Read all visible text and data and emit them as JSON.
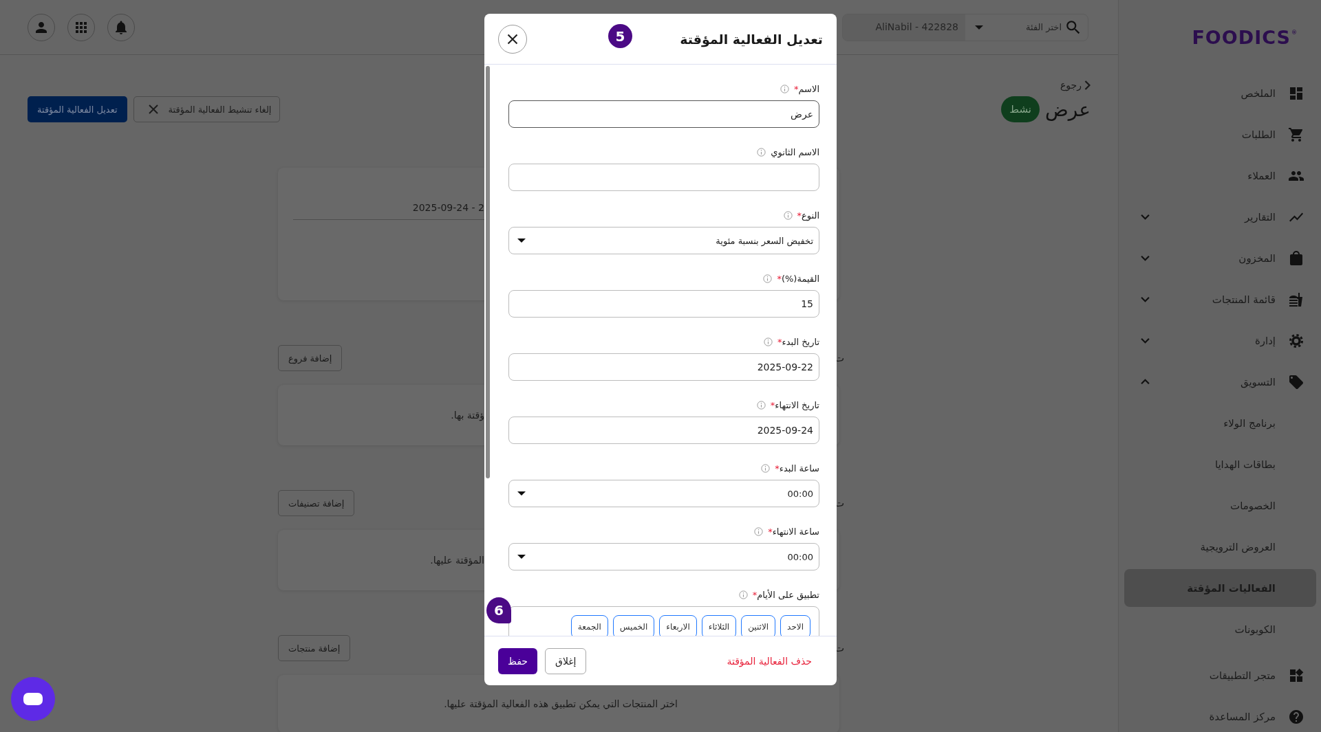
{
  "topbar": {
    "category_placeholder": "اختر الفئة",
    "account": "AliNabil - 422828"
  },
  "page": {
    "back": "رجوع",
    "title": "عرض",
    "status": "نشط",
    "actions": [
      {
        "label": "إلغاء تنشيط الفعالية المؤقتة",
        "kind": "outlined"
      },
      {
        "label": "تعديل الفعالية المؤقتة",
        "kind": "filled"
      }
    ]
  },
  "sections": [
    {
      "kind": "period",
      "value": "2025-09-24 - 2"
    },
    {
      "kind": "list",
      "heading": "ت",
      "button": "إضافة فروع",
      "text": "ؤقتة بها."
    },
    {
      "kind": "list",
      "heading": "ت",
      "button": "إضافة تصنيفات",
      "text": "المؤقتة عليها."
    },
    {
      "kind": "list",
      "heading": "ت",
      "button": "إضافة منتجات",
      "text": "اختر المنتجات التي يمكن تطبيق هذه الفعالية المؤقتة عليها."
    }
  ],
  "modal": {
    "title": "تعديل الفعالية المؤقتة",
    "marker": "5",
    "required_mark": "*",
    "fields": [
      {
        "kind": "text",
        "label": "الاسم",
        "required": true,
        "focused": true,
        "value": "عرض"
      },
      {
        "kind": "text",
        "label": "الاسم الثانوي",
        "required": false,
        "focused": false
      },
      {
        "kind": "select",
        "label": "النوع",
        "required": true,
        "focused": false,
        "value": "تخفيض السعر بنسبة مئوية"
      },
      {
        "kind": "text",
        "label": "القيمة(%)",
        "required": true,
        "focused": false,
        "value": "15"
      },
      {
        "kind": "text",
        "label": "تاريخ البدء",
        "required": true,
        "focused": false,
        "value": "2025-09-22"
      },
      {
        "kind": "text",
        "label": "تاريخ الانتهاء",
        "required": true,
        "focused": false,
        "value": "2025-09-24"
      },
      {
        "kind": "select",
        "label": "ساعة البدء",
        "required": true,
        "focused": false,
        "value": "00:00"
      },
      {
        "kind": "select",
        "label": "ساعة الانتهاء",
        "required": true,
        "focused": false,
        "value": "00:00"
      }
    ],
    "days": {
      "label": "تطبيق على الأيام",
      "required": true,
      "marker": "6",
      "items": [
        {
          "label": "الاحد",
          "selected": true
        },
        {
          "label": "الاثنين",
          "selected": true
        },
        {
          "label": "الثلاثاء",
          "selected": true
        },
        {
          "label": "الاربعاء",
          "selected": true
        },
        {
          "label": "الخميس",
          "selected": true
        },
        {
          "label": "الجمعة",
          "selected": true
        }
      ]
    },
    "delete": "حذف الفعالية المؤقتة",
    "buttons": [
      {
        "label": "إغلاق",
        "kind": "secondary"
      },
      {
        "label": "حفظ",
        "kind": "primary"
      }
    ]
  },
  "sidebar": {
    "logo": "FOODICS$^{®}$",
    "items": [
      {
        "label": "الملخص",
        "selected": false
      },
      {
        "label": "الطلبات",
        "selected": false
      },
      {
        "label": "العملاء",
        "selected": false
      },
      {
        "label": "التقارير",
        "selected": false,
        "expanded": false
      },
      {
        "label": "المخزون",
        "selected": false,
        "expanded": false
      },
      {
        "label": "قائمة المنتجات",
        "selected": false,
        "expanded": false
      },
      {
        "label": "إدارة",
        "selected": false,
        "expanded": false
      },
      {
        "label": "التسويق",
        "selected": false,
        "expanded": true,
        "children": [
          {
            "label": "برنامج الولاء",
            "selected": false
          },
          {
            "label": "بطاقات الهدايا",
            "selected": false
          },
          {
            "label": "الخصومات",
            "selected": false
          },
          {
            "label": "العروض الترويجية",
            "selected": false
          },
          {
            "label": "الفعاليات المؤقتة",
            "selected": true
          },
          {
            "label": "الكوبونات",
            "selected": false
          }
        ]
      }
    ],
    "bottom_items": [
      {
        "label": "متجر التطبيقات",
        "selected": false
      },
      {
        "label": "مركز المساعدة",
        "selected": false
      }
    ]
  }
}
